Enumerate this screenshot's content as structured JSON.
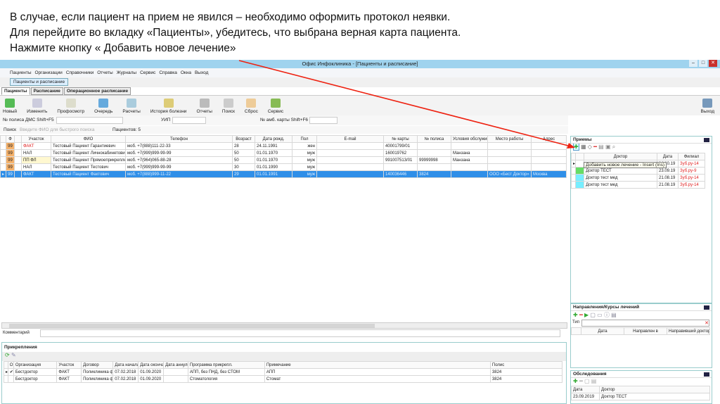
{
  "instructions": [
    "В случае, если пациент на прием не явился – необходимо оформить протокол неявки.",
    "Для перейдите во вкладку «Пациенты», убедитесь, что выбрана верная карта пациента.",
    "Нажмите кнопку « Добавить новое лечение»"
  ],
  "window": {
    "title": "Офис Инфоклиника - [Пациенты и расписание]"
  },
  "menu": [
    "Пациенты",
    "Организации",
    "Справочники",
    "Отчеты",
    "Журналы",
    "Сервис",
    "Справка",
    "Окна",
    "Выход"
  ],
  "doc_tab": "Пациенты и расписание",
  "tabs": [
    "Пациенты",
    "Расписание",
    "Операционное расписание"
  ],
  "toolbar": [
    "Новый",
    "Изменить",
    "Профосмотр",
    "Очередь",
    "Расчеты",
    "История болезни",
    "Отчеты",
    "Поиск",
    "Сброс",
    "Сервис"
  ],
  "exit_label": "Выход",
  "filter": {
    "policy_label": "№ полиса ДМС Shift+F5",
    "uip_label": "УИП",
    "card_label": "№ амб. карты Shift+F6"
  },
  "search": {
    "label": "Поиск",
    "placeholder": "Введите ФИО для быстрого поиска",
    "count": "Пациентов: 5"
  },
  "grid": {
    "columns": [
      "Ф",
      "Участок",
      "ФИО",
      "Телефон",
      "Возраст",
      "Дата рожд.",
      "Пол",
      "E-mail",
      "№ карты",
      "№ полиса",
      "Условия обслуживания",
      "Место работы",
      "Адрес"
    ],
    "rows": [
      [
        "99",
        "ФАКТ",
        "Тестовый Пациент Гарантиевич",
        "моб. +7(888)111-22-33",
        "28",
        "24.11.1991",
        "жен",
        "",
        "40001799/01",
        "",
        "",
        "",
        ""
      ],
      [
        "99",
        "НАЛ",
        "Тестовый Пациент Личнокабинетович",
        "моб. +7(999)999-99-99",
        "50",
        "01.01.1970",
        "муж",
        "",
        "160019762",
        "",
        "Манзана",
        "",
        ""
      ],
      [
        "99",
        "ПП ФЛ",
        "Тестовый Пациент Прямоеприкреплен",
        "моб. +7(964)065-88-28",
        "50",
        "01.01.1970",
        "муж",
        "",
        "991007513/01",
        "99999998",
        "Манзана",
        "",
        ""
      ],
      [
        "99",
        "НАЛ",
        "Тестовый Пациент Тестович",
        "моб. +7(999)999-99-99",
        "30",
        "01.01.1990",
        "муж",
        "",
        "",
        "",
        "",
        "",
        ""
      ],
      [
        "99",
        "ФАКТ",
        "Тестовый Пациент Фактович",
        "моб. +7(888)999-11-22",
        "29",
        "01.01.1991",
        "муж",
        "",
        "140036446",
        "3824",
        "",
        "ООО «Бест Доктор»",
        "Москва"
      ]
    ]
  },
  "comment_label": "Комментарий",
  "attach": {
    "title": "Прикрепления",
    "columns": [
      "О",
      "Организация",
      "Участок",
      "Договор",
      "Дата начала",
      "Дата окончания",
      "Дата аннулир.",
      "Программа прикрепл.",
      "Примечание",
      "Полис"
    ],
    "rows": [
      [
        "✔",
        "Бестдоктор",
        "ФАКТ",
        "Поликлиника факт",
        "07.02.2018",
        "01.09.2020",
        "",
        "АПП, без ПНД, без СТОМ",
        "АПП",
        "3824"
      ],
      [
        "",
        "Бестдоктор",
        "ФАКТ",
        "Поликлиника факт",
        "07.02.2018",
        "01.09.2020",
        "",
        "Стоматология",
        "Стомат",
        "3824"
      ]
    ]
  },
  "visits": {
    "title": "Приемы",
    "tooltip": "Добавить новое лечение  - Insert (Ins)",
    "columns": [
      "Доктор",
      "Дата",
      "Филиал"
    ],
    "rows": [
      [
        "",
        "14.10.19",
        "Зуб.ру-14"
      ],
      [
        "Доктор ТЕСТ",
        "23.09.19",
        "Зуб.ру-9"
      ],
      [
        "Доктор тест мед",
        "21.08.19",
        "Зуб.ру-14"
      ],
      [
        "Доктор тест мед",
        "21.08.19",
        "Зуб.ру-14"
      ]
    ]
  },
  "directions": {
    "title": "Направления/Курсы лечений",
    "type_label": "Тип",
    "columns": [
      "Дата",
      "Направлен в",
      "Направивший доктор"
    ]
  },
  "exams": {
    "title": "Обследования",
    "columns": [
      "Дата",
      "Доктор"
    ],
    "rows": [
      [
        "23.09.2019",
        "Доктор ТЕСТ"
      ]
    ]
  }
}
